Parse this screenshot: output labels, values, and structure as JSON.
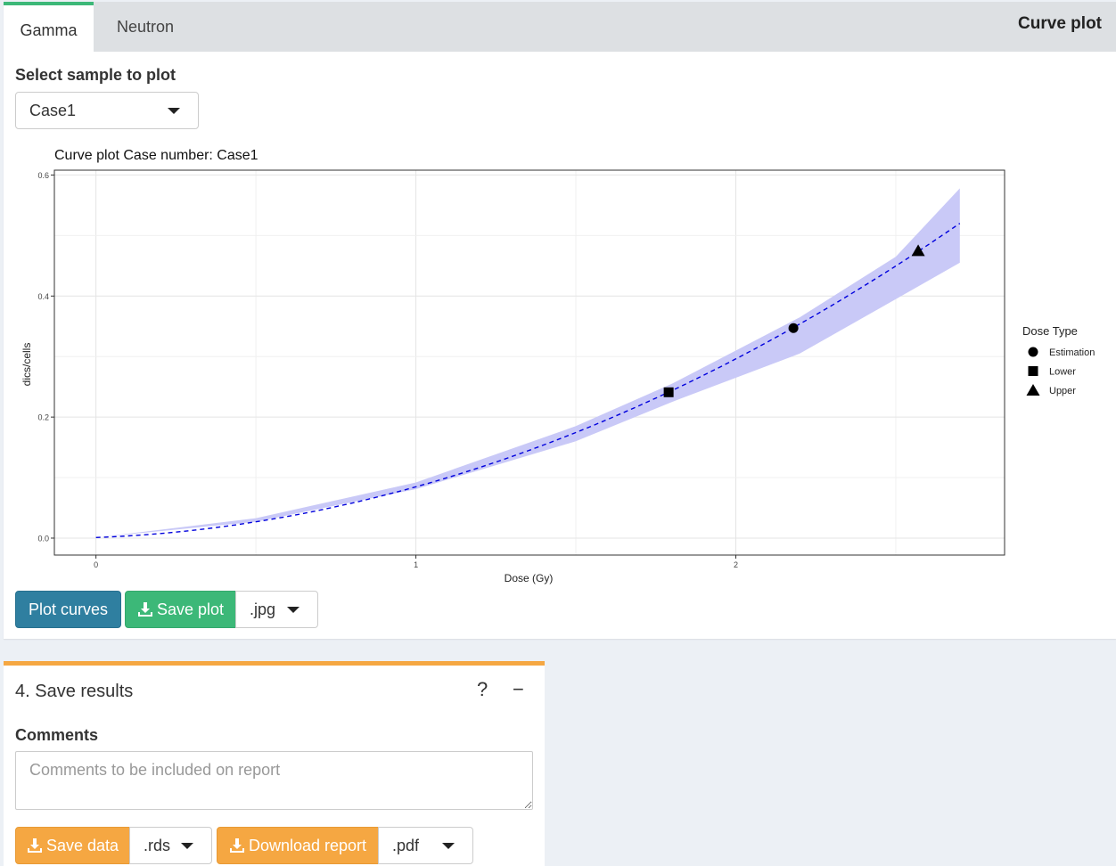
{
  "tabs": [
    {
      "label": "Gamma",
      "active": true
    },
    {
      "label": "Neutron",
      "active": false
    }
  ],
  "box_title": "Curve plot",
  "sample_label": "Select sample to plot",
  "sample_value": "Case1",
  "chart_title": "Curve plot Case number:  Case1",
  "plot_curves_label": "Plot curves",
  "save_plot_label": "Save plot",
  "plot_format": ".jpg",
  "save_results": {
    "title": "4. Save results",
    "help_icon": "?",
    "collapse_icon": "−",
    "comments_label": "Comments",
    "comments_placeholder": "Comments to be included on report",
    "save_data_label": "Save data",
    "data_format": ".rds",
    "download_report_label": "Download report",
    "report_format": ".pdf"
  },
  "colors": {
    "tab_accent": "#3cb878",
    "primary": "#2f7fa0",
    "success": "#3cb878",
    "warning": "#f5a742",
    "curve": "#0000dd",
    "band": "#c9c9f7"
  },
  "chart_data": {
    "type": "line",
    "xlabel": "Dose (Gy)",
    "ylabel": "dics/cells",
    "xlim": [
      -0.13,
      2.84
    ],
    "ylim": [
      -0.028,
      0.608
    ],
    "x_ticks": [
      "0",
      "1",
      "2"
    ],
    "y_ticks": [
      "0.0",
      "0.2",
      "0.4",
      "0.6"
    ],
    "grid": true,
    "curve": {
      "model": "quadratic",
      "coef_c": 0.001,
      "coef_alpha": 0.02,
      "coef_beta": 0.0638,
      "x_max": 2.7,
      "style": "dashed"
    },
    "band": {
      "upper": [
        [
          0,
          0.001
        ],
        [
          0.5,
          0.033
        ],
        [
          1,
          0.092
        ],
        [
          1.5,
          0.185
        ],
        [
          1.8,
          0.255
        ],
        [
          2.2,
          0.365
        ],
        [
          2.5,
          0.465
        ],
        [
          2.7,
          0.578
        ]
      ],
      "lower": [
        [
          0,
          0.001
        ],
        [
          0.5,
          0.027
        ],
        [
          1,
          0.081
        ],
        [
          1.5,
          0.16
        ],
        [
          1.8,
          0.225
        ],
        [
          2.2,
          0.305
        ],
        [
          2.5,
          0.395
        ],
        [
          2.7,
          0.455
        ]
      ]
    },
    "legend_title": "Dose Type",
    "legend_position": "right",
    "points": [
      {
        "name": "Estimation",
        "shape": "circle",
        "x": 2.18,
        "y": 0.347
      },
      {
        "name": "Lower",
        "shape": "square",
        "x": 1.79,
        "y": 0.241
      },
      {
        "name": "Upper",
        "shape": "triangle",
        "x": 2.57,
        "y": 0.475
      }
    ]
  }
}
